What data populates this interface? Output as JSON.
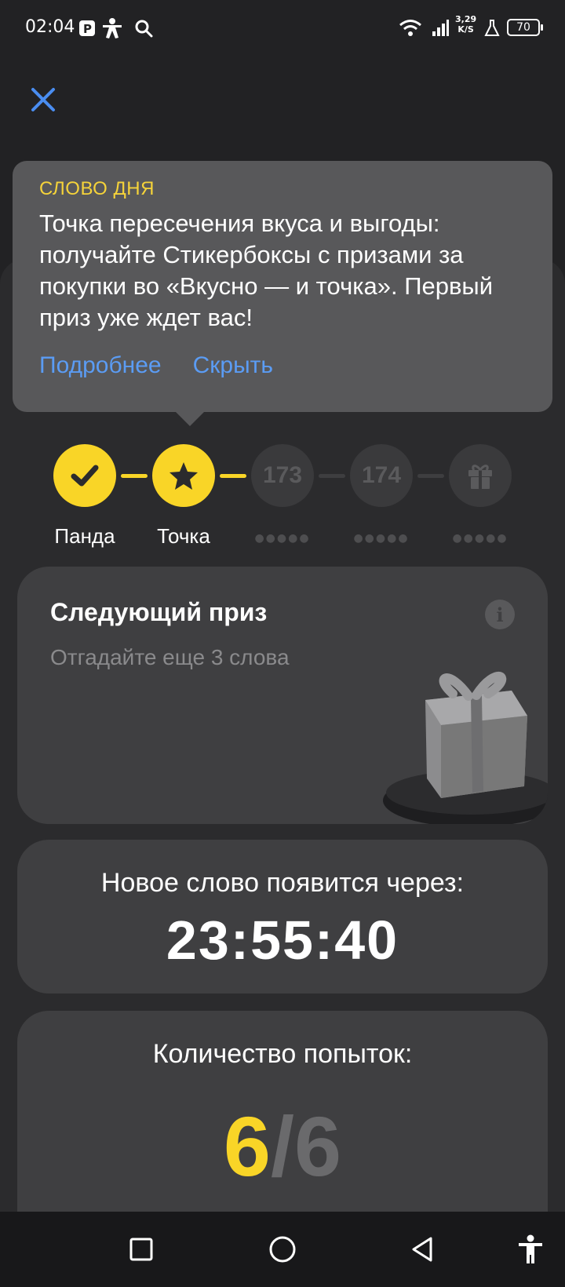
{
  "status_bar": {
    "time": "02:04",
    "net_speed_value": "3,29",
    "net_speed_unit": "K/S",
    "battery": "70"
  },
  "tooltip": {
    "title": "СЛОВО ДНЯ",
    "text": "Точка пересечения вкуса и выгоды: получайте Стикербоксы с призами за покупки во «Вкусно — и точка». Первый приз уже ждет вас!",
    "more_label": "Подробнее",
    "hide_label": "Скрыть"
  },
  "steps": [
    {
      "label": "Панда",
      "state": "done",
      "icon": "check-icon"
    },
    {
      "label": "Точка",
      "state": "current",
      "icon": "star-icon"
    },
    {
      "number": "173",
      "state": "locked"
    },
    {
      "number": "174",
      "state": "locked"
    },
    {
      "state": "locked",
      "icon": "gift-icon"
    }
  ],
  "prize_card": {
    "title": "Следующий приз",
    "subtitle": "Отгадайте еще 3 слова"
  },
  "timer_card": {
    "label": "Новое слово появится через:",
    "value": "23:55:40"
  },
  "tries_card": {
    "label": "Количество попыток:",
    "current": "6",
    "separator": "/",
    "max": "6"
  },
  "colors": {
    "accent_yellow": "#f9d527",
    "link_blue": "#5b9cf4",
    "close_blue": "#4a8df0",
    "background": "#222224",
    "card": "#3f3f41"
  }
}
